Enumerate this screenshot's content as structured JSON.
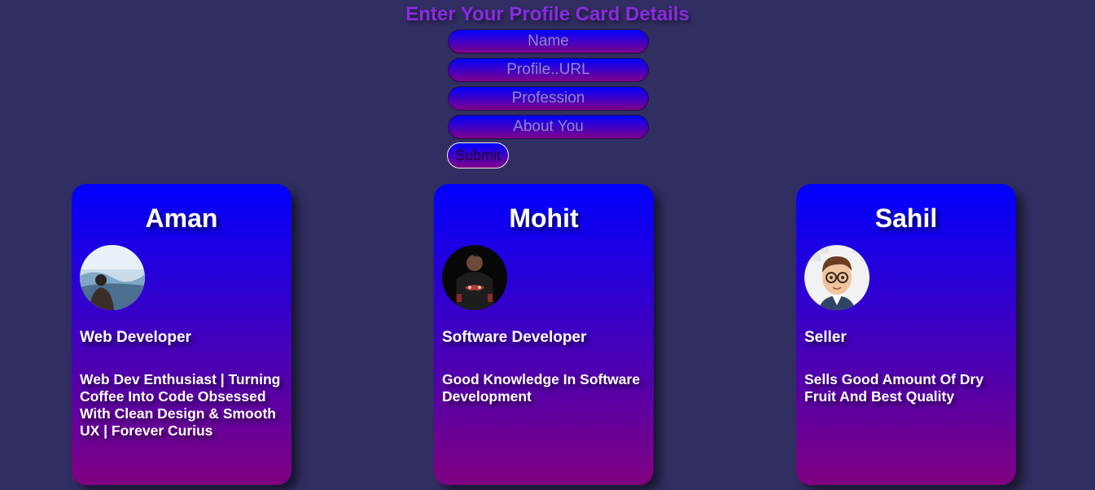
{
  "form": {
    "title": "Enter Your Profile Card Details",
    "name_placeholder": "Name",
    "url_placeholder": "Profile..URL",
    "profession_placeholder": "Profession",
    "about_placeholder": "About You",
    "submit_label": "Submit"
  },
  "cards": [
    {
      "name": "Aman",
      "profession": "Web Developer",
      "about": "Web Dev Enthusiast | Turning Coffee Into Code Obsessed With Clean Design & Smooth UX | Forever Curius",
      "avatar_icon": "person-photo-icon"
    },
    {
      "name": "Mohit",
      "profession": "Software Developer",
      "about": "Good Knowledge In Software Development",
      "avatar_icon": "person-photo-icon"
    },
    {
      "name": "Sahil",
      "profession": "Seller",
      "about": "Sells Good Amount Of Dry Fruit And Best Quality",
      "avatar_icon": "cartoon-avatar-icon"
    }
  ],
  "colors": {
    "background": "#312f62",
    "title": "#8a2be2",
    "gradient_top": "#0000ff",
    "gradient_bottom": "#800080"
  }
}
